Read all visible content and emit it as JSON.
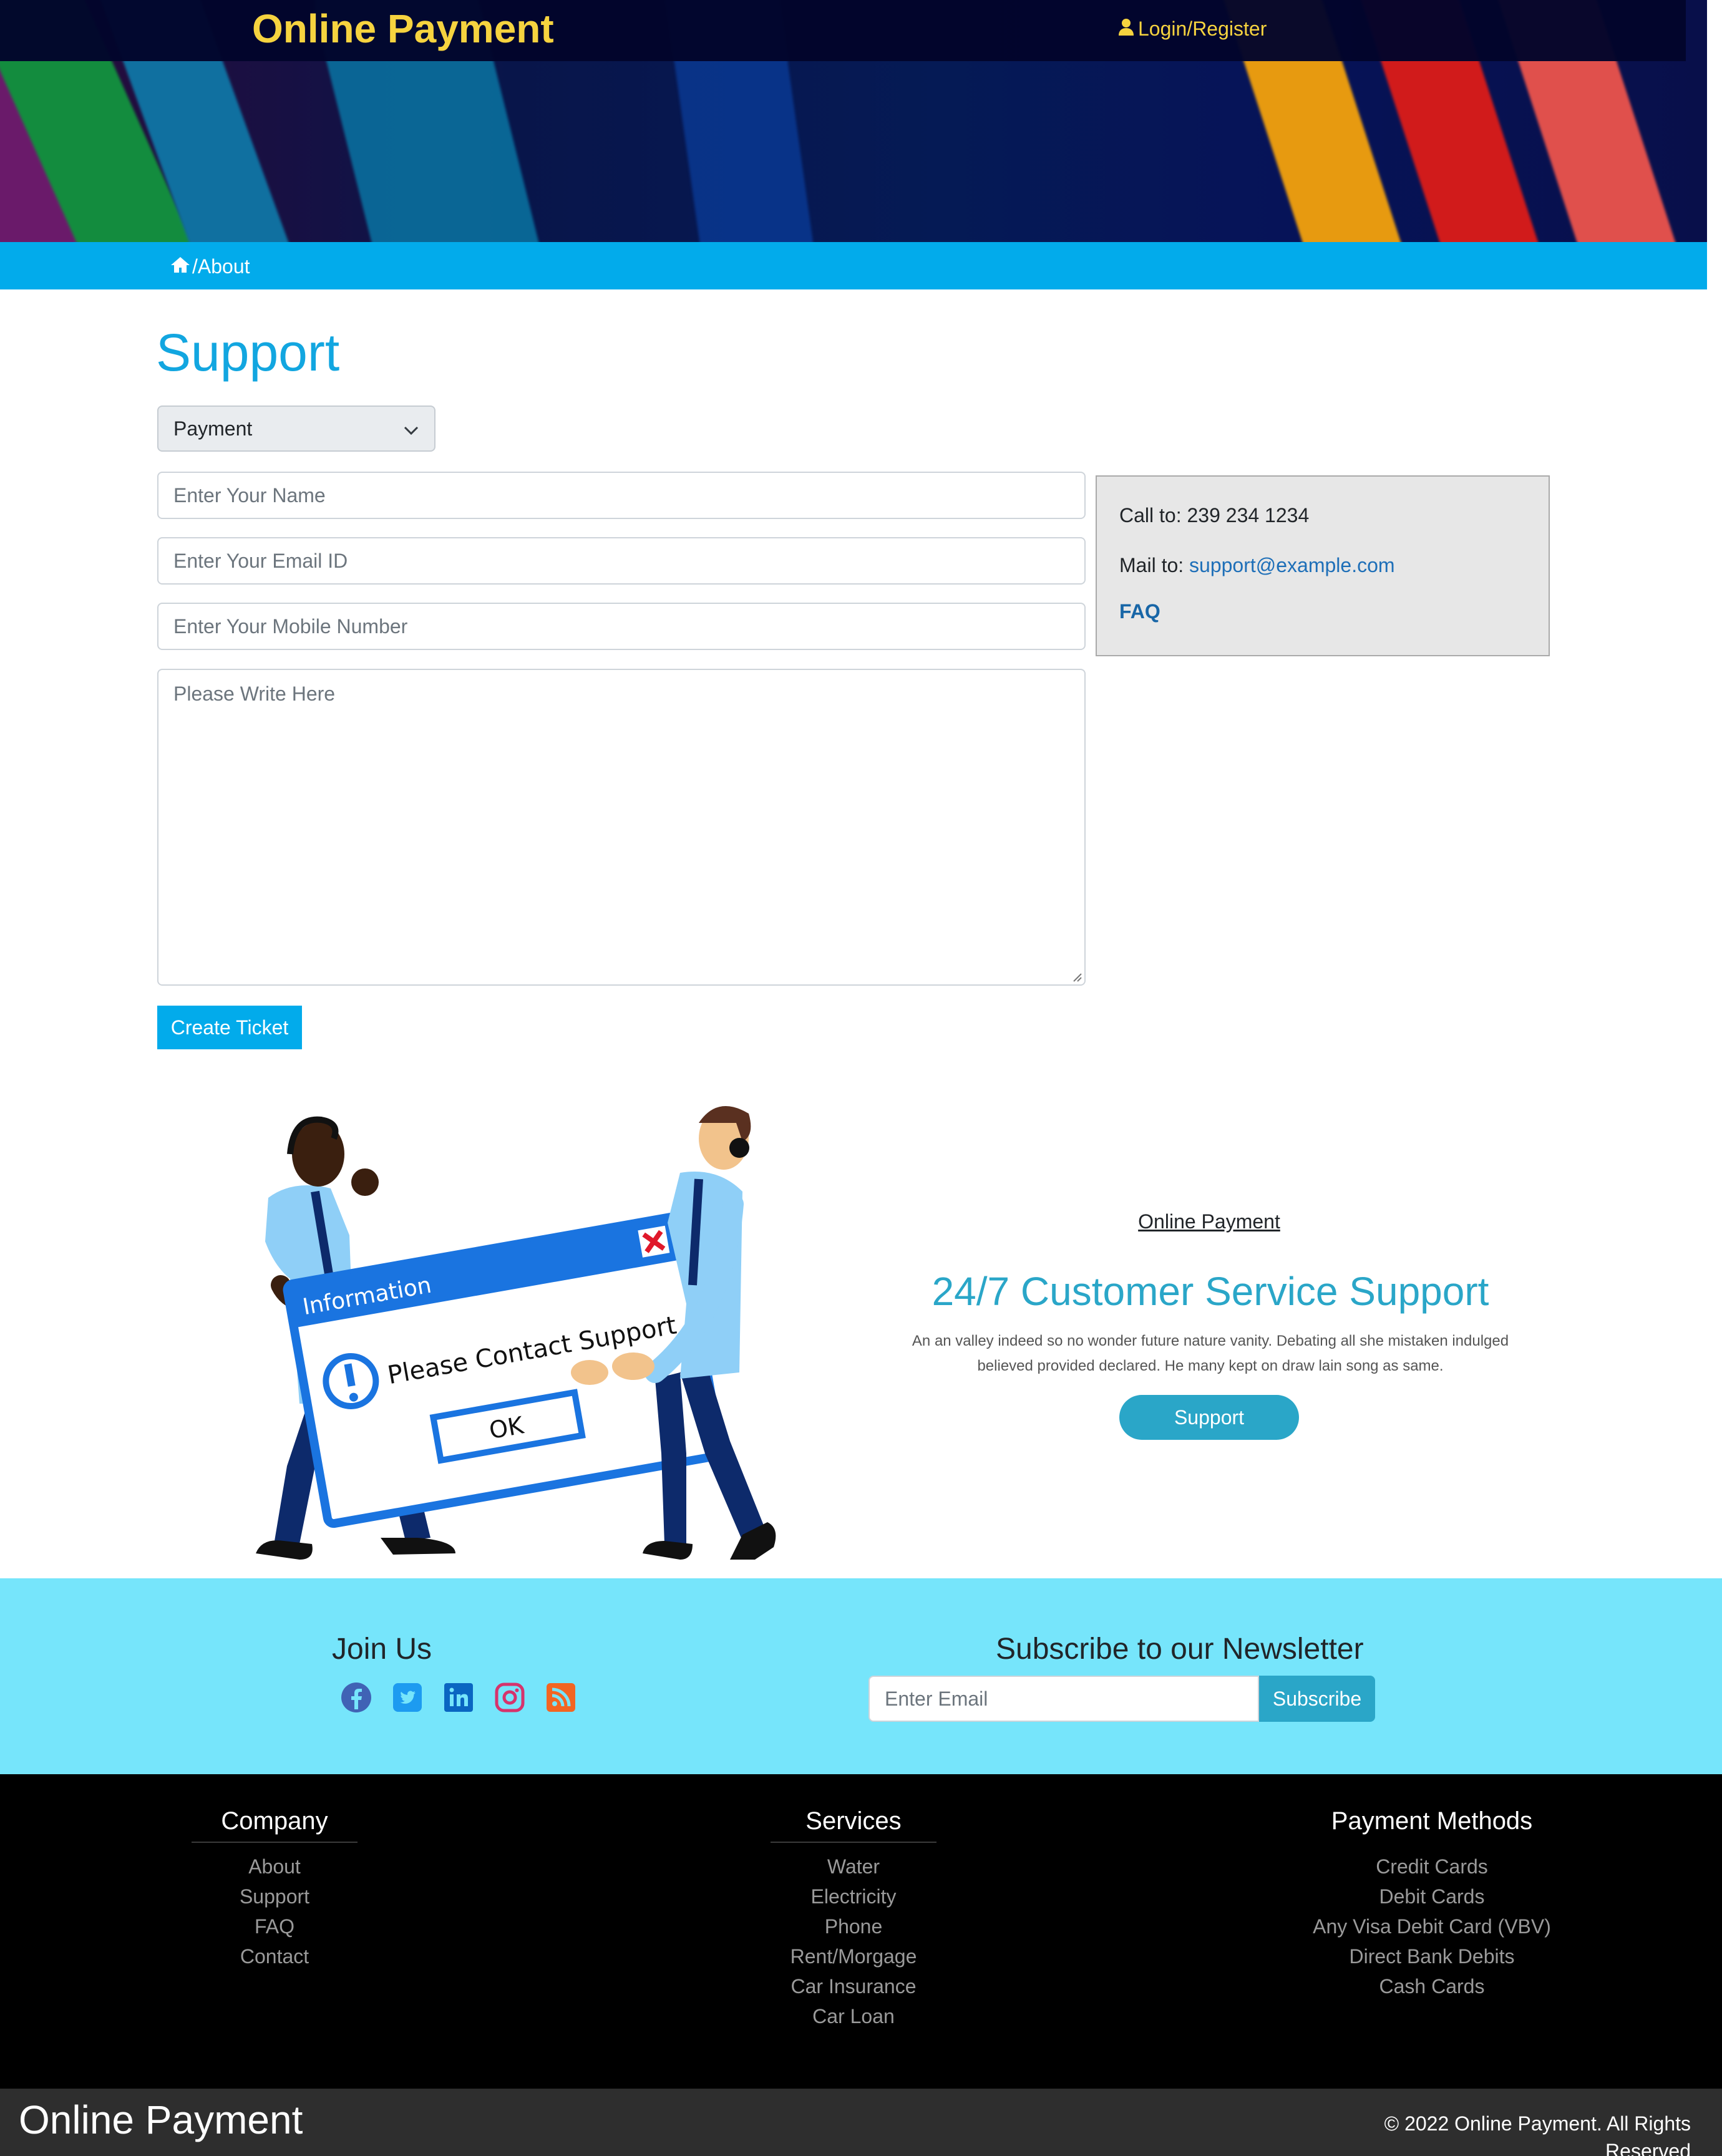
{
  "header": {
    "brand": "Online Payment",
    "login_label": "Login/Register"
  },
  "breadcrumb": {
    "current": "/About"
  },
  "support": {
    "title": "Support",
    "category_selected": "Payment",
    "name_placeholder": "Enter Your Name",
    "email_placeholder": "Enter Your Email ID",
    "mobile_placeholder": "Enter Your Mobile Number",
    "message_placeholder": "Please Write Here",
    "submit_label": "Create Ticket"
  },
  "contact": {
    "call_label": "Call to: 239 234 1234",
    "mail_prefix": "Mail to: ",
    "mail_link": "support@example.com",
    "faq_label": "FAQ"
  },
  "illustration": {
    "window_title": "Information",
    "message": "Please Contact Support",
    "ok_label": "OK"
  },
  "promo": {
    "kicker": "Online Payment",
    "title": "24/7 Customer Service Support",
    "text": "An an valley indeed so no wonder future nature vanity. Debating all she mistaken indulged believed provided declared. He many kept on draw lain song as same.",
    "button": "Support"
  },
  "join": {
    "title": "Join Us",
    "social": [
      "facebook-icon",
      "twitter-icon",
      "linkedin-icon",
      "instagram-icon",
      "rss-icon"
    ]
  },
  "newsletter": {
    "title": "Subscribe to our Newsletter",
    "placeholder": "Enter Email",
    "button": "Subscribe"
  },
  "footer": {
    "company": {
      "title": "Company",
      "items": [
        "About",
        "Support",
        "FAQ",
        "Contact"
      ]
    },
    "services": {
      "title": "Services",
      "items": [
        "Water",
        "Electricity",
        "Phone",
        "Rent/Morgage",
        "Car Insurance",
        "Car Loan"
      ]
    },
    "payment": {
      "title": "Payment Methods",
      "items": [
        "Credit Cards",
        "Debit Cards",
        "Any Visa Debit Card (VBV)",
        "Direct Bank Debits",
        "Cash Cards"
      ]
    },
    "brand": "Online Payment",
    "copyright": "© 2022 Online Payment. All Rights Reserved"
  },
  "colors": {
    "accent": "#02abeb",
    "brand_yellow": "#f6d33f",
    "teal": "#2aa6c8",
    "band": "#76e5fb"
  }
}
